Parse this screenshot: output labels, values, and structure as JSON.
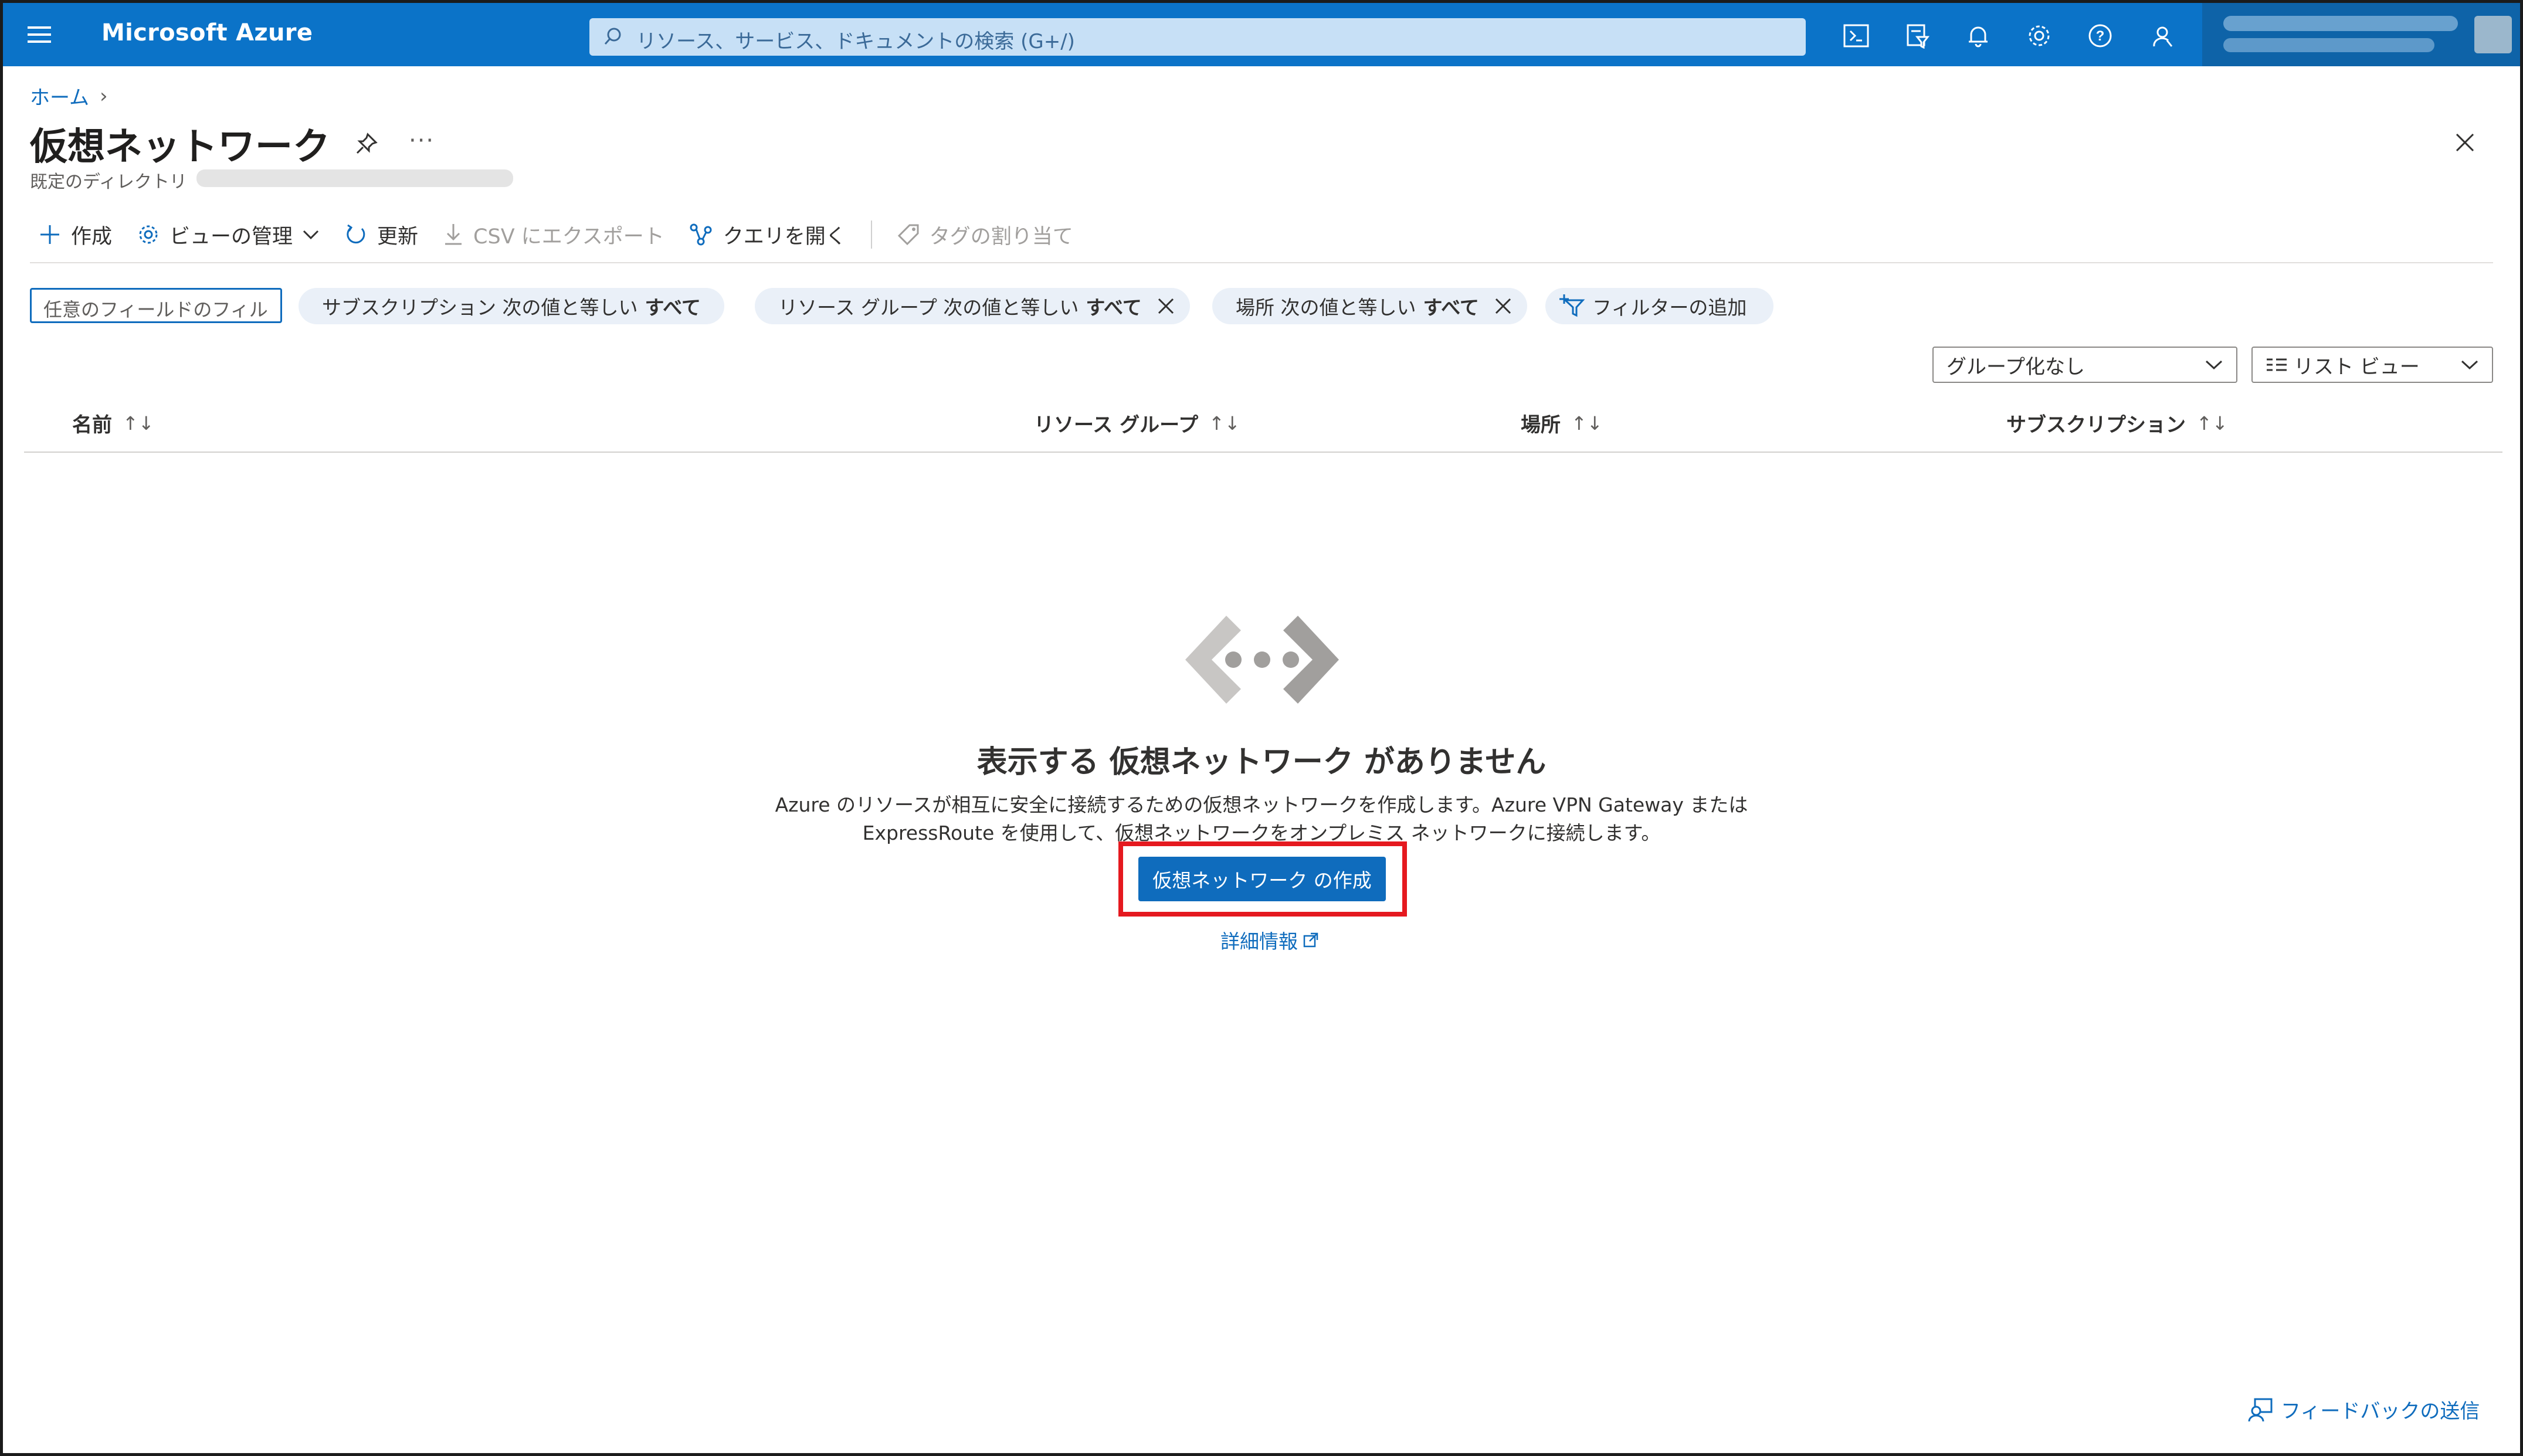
{
  "topbar": {
    "brand": "Microsoft Azure",
    "search_placeholder": "リソース、サービス、ドキュメントの検索 (G+/)",
    "icons": [
      "cloud-shell-icon",
      "directory-filter-icon",
      "notifications-icon",
      "settings-icon",
      "help-icon",
      "feedback-icon"
    ]
  },
  "breadcrumb": {
    "home": "ホーム"
  },
  "page": {
    "title": "仮想ネットワーク",
    "subtitle": "既定のディレクトリ"
  },
  "toolbar": {
    "create": "作成",
    "manage_view": "ビューの管理",
    "refresh": "更新",
    "export_csv": "CSV にエクスポート",
    "open_query": "クエリを開く",
    "assign_tags": "タグの割り当て"
  },
  "filters": {
    "input_placeholder": "任意のフィールドのフィル",
    "subscription": {
      "label": "サブスクリプション 次の値と等しい",
      "value": "すべて"
    },
    "resource_group": {
      "label": "リソース グループ 次の値と等しい",
      "value": "すべて"
    },
    "location": {
      "label": "場所 次の値と等しい",
      "value": "すべて"
    },
    "add_filter": "フィルターの追加"
  },
  "view_controls": {
    "grouping": "グループ化なし",
    "view_mode": "リスト ビュー"
  },
  "table": {
    "columns": [
      "名前",
      "リソース グループ",
      "場所",
      "サブスクリプション"
    ]
  },
  "empty_state": {
    "title": "表示する 仮想ネットワーク がありません",
    "description_line1": "Azure のリソースが相互に安全に接続するための仮想ネットワークを作成します。Azure VPN Gateway または",
    "description_line2": "ExpressRoute を使用して、仮想ネットワークをオンプレミス ネットワークに接続します。",
    "create_button": "仮想ネットワーク の作成",
    "learn_more": "詳細情報"
  },
  "footer": {
    "feedback": "フィードバックの送信"
  },
  "colors": {
    "topbar": "#0b73c8",
    "accent": "#0f6cbd",
    "highlight": "#e5191f",
    "pill": "#eaf0f8"
  }
}
